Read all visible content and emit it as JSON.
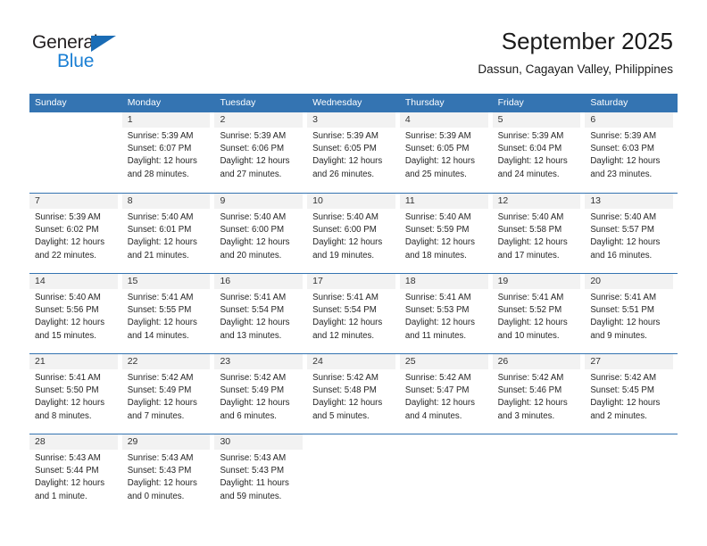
{
  "brand": {
    "name_part1": "General",
    "name_part2": "Blue",
    "triangle_color": "#1a6cb5",
    "blue_text_color": "#1a7fd4"
  },
  "header": {
    "title": "September 2025",
    "subtitle": "Dassun, Cagayan Valley, Philippines",
    "accent_color": "#3474b2",
    "day_band_color": "#f2f2f2"
  },
  "weekdays": [
    "Sunday",
    "Monday",
    "Tuesday",
    "Wednesday",
    "Thursday",
    "Friday",
    "Saturday"
  ],
  "weeks": [
    [
      {
        "day": "",
        "lines": []
      },
      {
        "day": "1",
        "lines": [
          "Sunrise: 5:39 AM",
          "Sunset: 6:07 PM",
          "Daylight: 12 hours",
          "and 28 minutes."
        ]
      },
      {
        "day": "2",
        "lines": [
          "Sunrise: 5:39 AM",
          "Sunset: 6:06 PM",
          "Daylight: 12 hours",
          "and 27 minutes."
        ]
      },
      {
        "day": "3",
        "lines": [
          "Sunrise: 5:39 AM",
          "Sunset: 6:05 PM",
          "Daylight: 12 hours",
          "and 26 minutes."
        ]
      },
      {
        "day": "4",
        "lines": [
          "Sunrise: 5:39 AM",
          "Sunset: 6:05 PM",
          "Daylight: 12 hours",
          "and 25 minutes."
        ]
      },
      {
        "day": "5",
        "lines": [
          "Sunrise: 5:39 AM",
          "Sunset: 6:04 PM",
          "Daylight: 12 hours",
          "and 24 minutes."
        ]
      },
      {
        "day": "6",
        "lines": [
          "Sunrise: 5:39 AM",
          "Sunset: 6:03 PM",
          "Daylight: 12 hours",
          "and 23 minutes."
        ]
      }
    ],
    [
      {
        "day": "7",
        "lines": [
          "Sunrise: 5:39 AM",
          "Sunset: 6:02 PM",
          "Daylight: 12 hours",
          "and 22 minutes."
        ]
      },
      {
        "day": "8",
        "lines": [
          "Sunrise: 5:40 AM",
          "Sunset: 6:01 PM",
          "Daylight: 12 hours",
          "and 21 minutes."
        ]
      },
      {
        "day": "9",
        "lines": [
          "Sunrise: 5:40 AM",
          "Sunset: 6:00 PM",
          "Daylight: 12 hours",
          "and 20 minutes."
        ]
      },
      {
        "day": "10",
        "lines": [
          "Sunrise: 5:40 AM",
          "Sunset: 6:00 PM",
          "Daylight: 12 hours",
          "and 19 minutes."
        ]
      },
      {
        "day": "11",
        "lines": [
          "Sunrise: 5:40 AM",
          "Sunset: 5:59 PM",
          "Daylight: 12 hours",
          "and 18 minutes."
        ]
      },
      {
        "day": "12",
        "lines": [
          "Sunrise: 5:40 AM",
          "Sunset: 5:58 PM",
          "Daylight: 12 hours",
          "and 17 minutes."
        ]
      },
      {
        "day": "13",
        "lines": [
          "Sunrise: 5:40 AM",
          "Sunset: 5:57 PM",
          "Daylight: 12 hours",
          "and 16 minutes."
        ]
      }
    ],
    [
      {
        "day": "14",
        "lines": [
          "Sunrise: 5:40 AM",
          "Sunset: 5:56 PM",
          "Daylight: 12 hours",
          "and 15 minutes."
        ]
      },
      {
        "day": "15",
        "lines": [
          "Sunrise: 5:41 AM",
          "Sunset: 5:55 PM",
          "Daylight: 12 hours",
          "and 14 minutes."
        ]
      },
      {
        "day": "16",
        "lines": [
          "Sunrise: 5:41 AM",
          "Sunset: 5:54 PM",
          "Daylight: 12 hours",
          "and 13 minutes."
        ]
      },
      {
        "day": "17",
        "lines": [
          "Sunrise: 5:41 AM",
          "Sunset: 5:54 PM",
          "Daylight: 12 hours",
          "and 12 minutes."
        ]
      },
      {
        "day": "18",
        "lines": [
          "Sunrise: 5:41 AM",
          "Sunset: 5:53 PM",
          "Daylight: 12 hours",
          "and 11 minutes."
        ]
      },
      {
        "day": "19",
        "lines": [
          "Sunrise: 5:41 AM",
          "Sunset: 5:52 PM",
          "Daylight: 12 hours",
          "and 10 minutes."
        ]
      },
      {
        "day": "20",
        "lines": [
          "Sunrise: 5:41 AM",
          "Sunset: 5:51 PM",
          "Daylight: 12 hours",
          "and 9 minutes."
        ]
      }
    ],
    [
      {
        "day": "21",
        "lines": [
          "Sunrise: 5:41 AM",
          "Sunset: 5:50 PM",
          "Daylight: 12 hours",
          "and 8 minutes."
        ]
      },
      {
        "day": "22",
        "lines": [
          "Sunrise: 5:42 AM",
          "Sunset: 5:49 PM",
          "Daylight: 12 hours",
          "and 7 minutes."
        ]
      },
      {
        "day": "23",
        "lines": [
          "Sunrise: 5:42 AM",
          "Sunset: 5:49 PM",
          "Daylight: 12 hours",
          "and 6 minutes."
        ]
      },
      {
        "day": "24",
        "lines": [
          "Sunrise: 5:42 AM",
          "Sunset: 5:48 PM",
          "Daylight: 12 hours",
          "and 5 minutes."
        ]
      },
      {
        "day": "25",
        "lines": [
          "Sunrise: 5:42 AM",
          "Sunset: 5:47 PM",
          "Daylight: 12 hours",
          "and 4 minutes."
        ]
      },
      {
        "day": "26",
        "lines": [
          "Sunrise: 5:42 AM",
          "Sunset: 5:46 PM",
          "Daylight: 12 hours",
          "and 3 minutes."
        ]
      },
      {
        "day": "27",
        "lines": [
          "Sunrise: 5:42 AM",
          "Sunset: 5:45 PM",
          "Daylight: 12 hours",
          "and 2 minutes."
        ]
      }
    ],
    [
      {
        "day": "28",
        "lines": [
          "Sunrise: 5:43 AM",
          "Sunset: 5:44 PM",
          "Daylight: 12 hours",
          "and 1 minute."
        ]
      },
      {
        "day": "29",
        "lines": [
          "Sunrise: 5:43 AM",
          "Sunset: 5:43 PM",
          "Daylight: 12 hours",
          "and 0 minutes."
        ]
      },
      {
        "day": "30",
        "lines": [
          "Sunrise: 5:43 AM",
          "Sunset: 5:43 PM",
          "Daylight: 11 hours",
          "and 59 minutes."
        ]
      },
      {
        "day": "",
        "lines": []
      },
      {
        "day": "",
        "lines": []
      },
      {
        "day": "",
        "lines": []
      },
      {
        "day": "",
        "lines": []
      }
    ]
  ]
}
